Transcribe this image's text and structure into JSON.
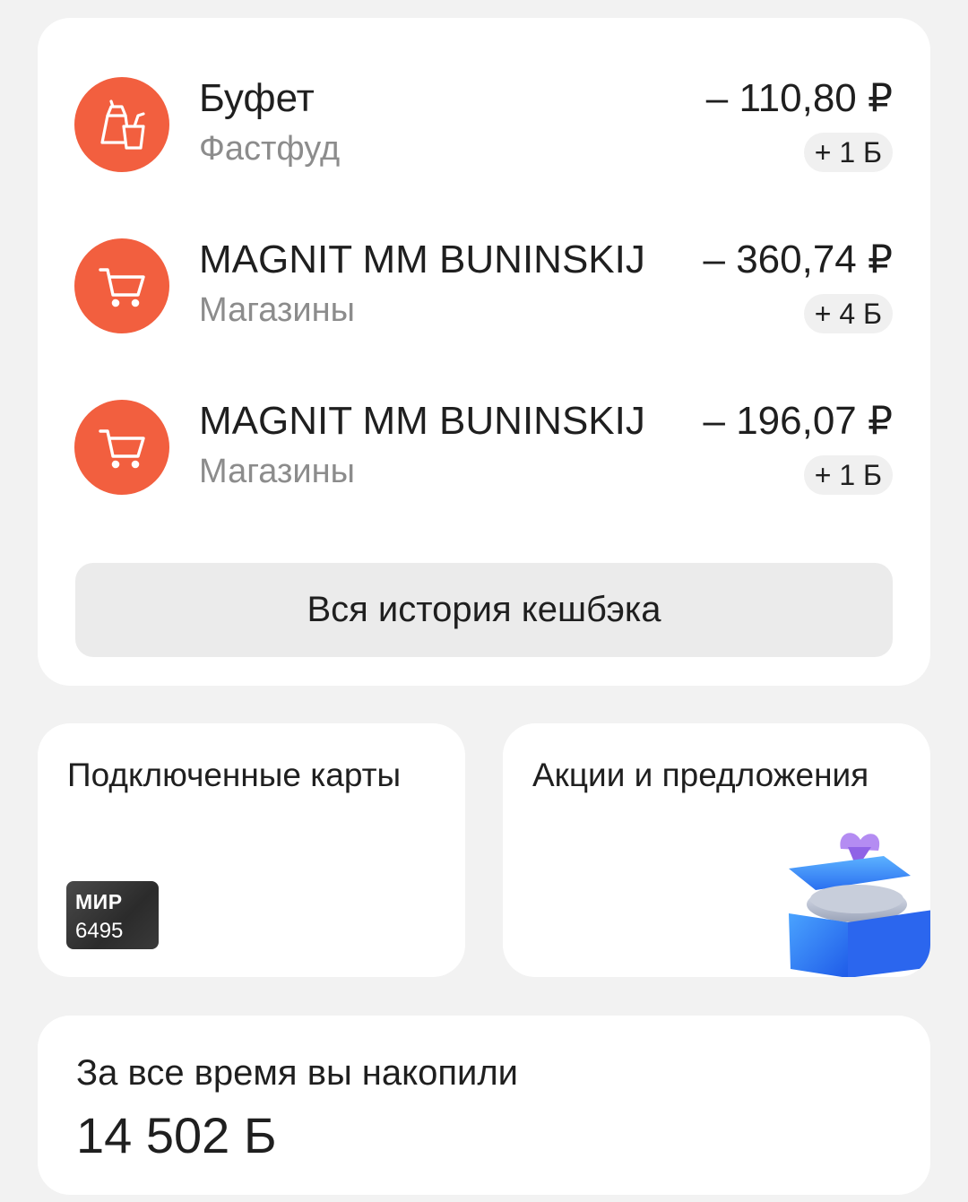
{
  "transactions": [
    {
      "title": "Буфет",
      "category": "Фастфуд",
      "amount": "– 110,80 ₽",
      "bonus": "+ 1 Б",
      "icon": "fastfood-icon"
    },
    {
      "title": "MAGNIT MM BUNINSKIJ",
      "category": "Магазины",
      "amount": "– 360,74 ₽",
      "bonus": "+ 4 Б",
      "icon": "shopping-cart-icon"
    },
    {
      "title": "MAGNIT MM BUNINSKIJ",
      "category": "Магазины",
      "amount": "– 196,07 ₽",
      "bonus": "+ 1 Б",
      "icon": "shopping-cart-icon"
    }
  ],
  "history_button": "Вся история кешбэка",
  "linked_cards": {
    "title": "Подключенные карты",
    "card_brand": "МИР",
    "card_last4": "6495"
  },
  "promo": {
    "title": "Акции и предложения",
    "icon": "gift-box-coins-icon"
  },
  "total": {
    "label": "За все время вы накопили",
    "value": "14 502 Б"
  },
  "colors": {
    "accent": "#f25f3f",
    "background": "#f2f2f2",
    "card": "#ffffff",
    "secondary_text": "#8c8c8c"
  }
}
